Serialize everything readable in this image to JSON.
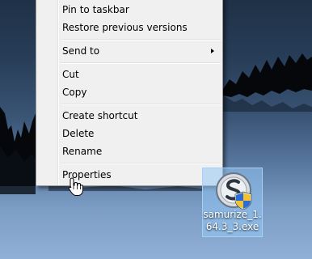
{
  "context_menu": {
    "items": [
      {
        "label": "Pin to taskbar"
      },
      {
        "label": "Restore previous versions"
      },
      {
        "label": "Send to"
      },
      {
        "label": "Cut"
      },
      {
        "label": "Copy"
      },
      {
        "label": "Create shortcut"
      },
      {
        "label": "Delete"
      },
      {
        "label": "Rename"
      },
      {
        "label": "Properties"
      }
    ]
  },
  "desktop_icon": {
    "label": "samurize_1.64.3_3.exe",
    "icon": "samurize-shield-icon"
  },
  "cursor": {
    "icon": "hand-pointer-icon"
  }
}
